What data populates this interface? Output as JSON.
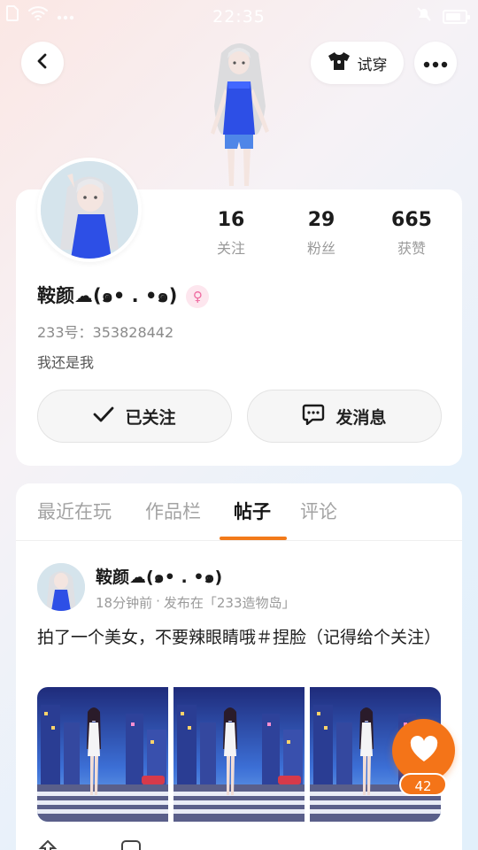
{
  "status_bar": {
    "time": "22:35",
    "icons": [
      "sim-icon",
      "wifi-icon",
      "dots-icon",
      "mute-icon",
      "battery-icon"
    ],
    "battery_level": 0.8
  },
  "header": {
    "tryon_label": "试穿",
    "icons": [
      "back-icon",
      "tshirt-icon",
      "more-icon"
    ]
  },
  "profile": {
    "stats": [
      {
        "value": "16",
        "label": "关注"
      },
      {
        "value": "29",
        "label": "粉丝"
      },
      {
        "value": "665",
        "label": "获赞"
      }
    ],
    "username": "鞍颜☁️(๑•̀ㅂ•́)",
    "username_display": "鞍颜☁(๑• . •๑)",
    "gender_icon": "female-icon",
    "uid": "233号：353828442",
    "bio": "我还是我",
    "follow_label": "已关注",
    "message_label": "发消息"
  },
  "tabs": [
    {
      "label": "最近在玩",
      "active": false
    },
    {
      "label": "作品栏",
      "active": false
    },
    {
      "label": "帖子",
      "active": true
    },
    {
      "label": "评论",
      "active": false
    }
  ],
  "post": {
    "author": "鞍颜☁(๑• . •๑)",
    "time": "18分钟前",
    "separator": "·",
    "published_in": "发布在「233造物岛」",
    "text": "拍了一个美女，不要辣眼睛哦＃捏脸（记得给个关注）",
    "image_count": 3
  },
  "like": {
    "count": "42",
    "accent": "#f47418"
  },
  "colors": {
    "accent": "#f27a1a",
    "text_primary": "#1b1b1b",
    "text_secondary": "#9a9a9a"
  }
}
